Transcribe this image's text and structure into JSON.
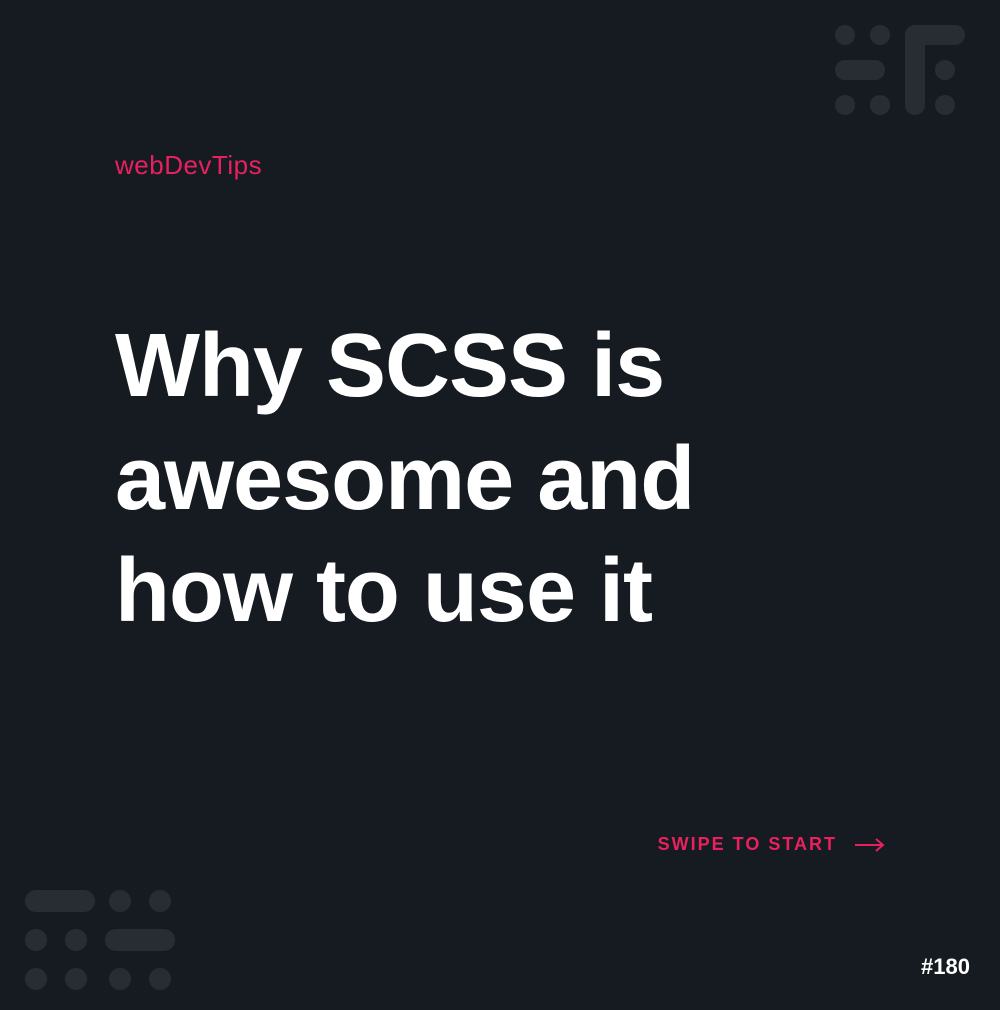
{
  "brand": "webDevTips",
  "title": "Why SCSS is awesome and how to use it",
  "cta": {
    "label": "SWIPE TO START"
  },
  "page_number": "#180",
  "colors": {
    "accent": "#e9205e",
    "background": "#151b21",
    "text": "#ffffff"
  }
}
